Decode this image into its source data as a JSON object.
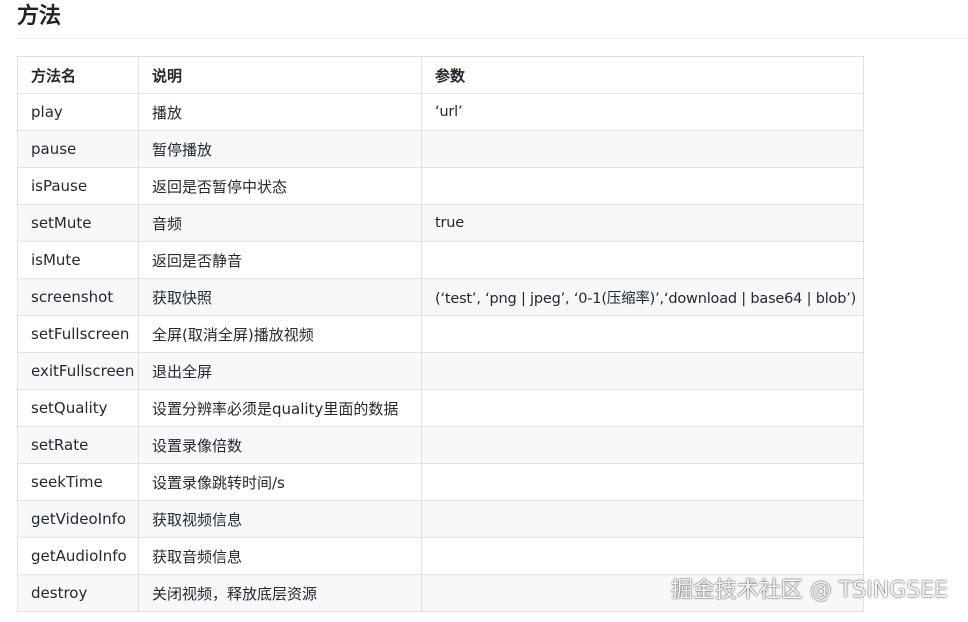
{
  "heading": "方法",
  "table": {
    "headers": [
      "方法名",
      "说明",
      "参数"
    ],
    "rows": [
      {
        "name": "play",
        "desc": "播放",
        "param": "‘url’"
      },
      {
        "name": "pause",
        "desc": "暂停播放",
        "param": ""
      },
      {
        "name": "isPause",
        "desc": "返回是否暂停中状态",
        "param": ""
      },
      {
        "name": "setMute",
        "desc": "音频",
        "param": "true"
      },
      {
        "name": "isMute",
        "desc": "返回是否静音",
        "param": ""
      },
      {
        "name": "screenshot",
        "desc": "获取快照",
        "param": "(‘test’, ‘png | jpeg’, ‘0-1(压缩率)’,‘download | base64 | blob’)"
      },
      {
        "name": "setFullscreen",
        "desc": "全屏(取消全屏)播放视频",
        "param": ""
      },
      {
        "name": "exitFullscreen",
        "desc": "退出全屏",
        "param": ""
      },
      {
        "name": "setQuality",
        "desc": "设置分辨率必须是quality里面的数据",
        "param": ""
      },
      {
        "name": "setRate",
        "desc": "设置录像倍数",
        "param": ""
      },
      {
        "name": "seekTime",
        "desc": "设置录像跳转时间/s",
        "param": ""
      },
      {
        "name": "getVideoInfo",
        "desc": "获取视频信息",
        "param": ""
      },
      {
        "name": "getAudioInfo",
        "desc": "获取音频信息",
        "param": ""
      },
      {
        "name": "destroy",
        "desc": "关闭视频，释放底层资源",
        "param": ""
      }
    ]
  },
  "watermark": "掘金技术社区 @ TSINGSEE"
}
